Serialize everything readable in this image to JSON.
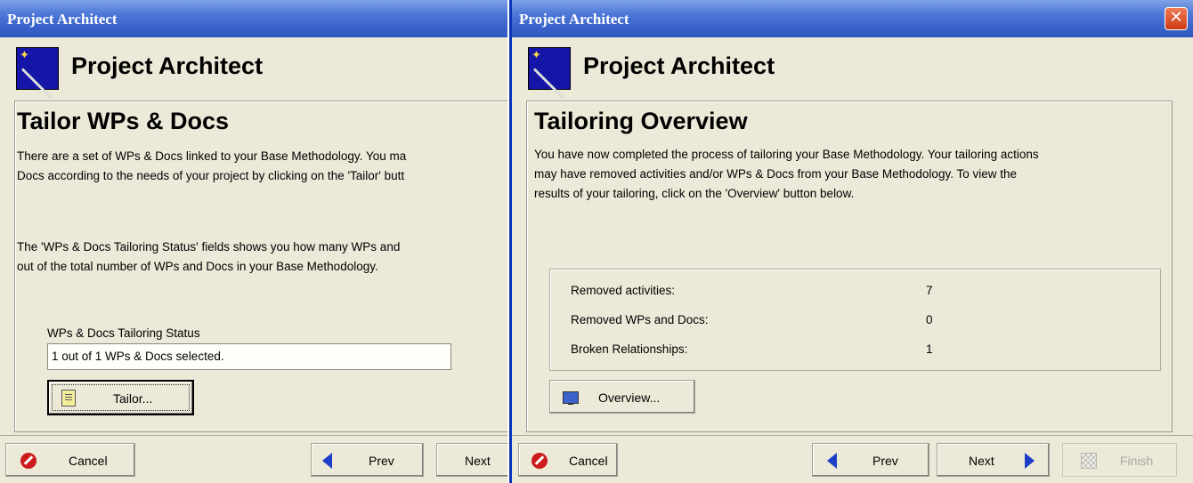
{
  "colors": {
    "title_bar": "#3a64cc",
    "window_bg": "#ece9d8",
    "close_button": "#d5471f",
    "nav_arrow": "#1d3fc7"
  },
  "left_window": {
    "title": "Project Architect",
    "header_title": "Project Architect",
    "page_title": "Tailor WPs & Docs",
    "para1_line1": "There are a set of WPs & Docs linked to your Base Methodology. You ma",
    "para1_line2": "Docs according to the needs of your project by clicking on the 'Tailor' butt",
    "para2_line1": "The 'WPs & Docs Tailoring Status' fields shows you how many WPs and",
    "para2_line2": "out of the total number of WPs and Docs in your Base Methodology.",
    "status_label": "WPs & Docs Tailoring Status",
    "status_value": "1 out of 1 WPs & Docs selected.",
    "tailor_button": "Tailor...",
    "cancel_button": "Cancel",
    "prev_button": "Prev",
    "next_button": "Next"
  },
  "right_window": {
    "title": "Project Architect",
    "header_title": "Project Architect",
    "page_title": "Tailoring Overview",
    "para_line1": "You have now completed the process of tailoring your Base Methodology. Your tailoring actions",
    "para_line2": "may have removed activities and/or WPs & Docs from your Base Methodology. To view the",
    "para_line3": "results of your tailoring, click on the 'Overview' button below.",
    "stats": [
      {
        "label": "Removed activities:",
        "value": "7"
      },
      {
        "label": "Removed WPs and Docs:",
        "value": "0"
      },
      {
        "label": "Broken Relationships:",
        "value": "1"
      }
    ],
    "overview_button": "Overview...",
    "cancel_button": "Cancel",
    "prev_button": "Prev",
    "next_button": "Next",
    "finish_button": "Finish"
  },
  "icons": [
    "wand-icon",
    "document-icon",
    "monitor-icon",
    "stop-icon",
    "prev-arrow-icon",
    "next-arrow-icon",
    "finish-icon",
    "close-icon"
  ]
}
